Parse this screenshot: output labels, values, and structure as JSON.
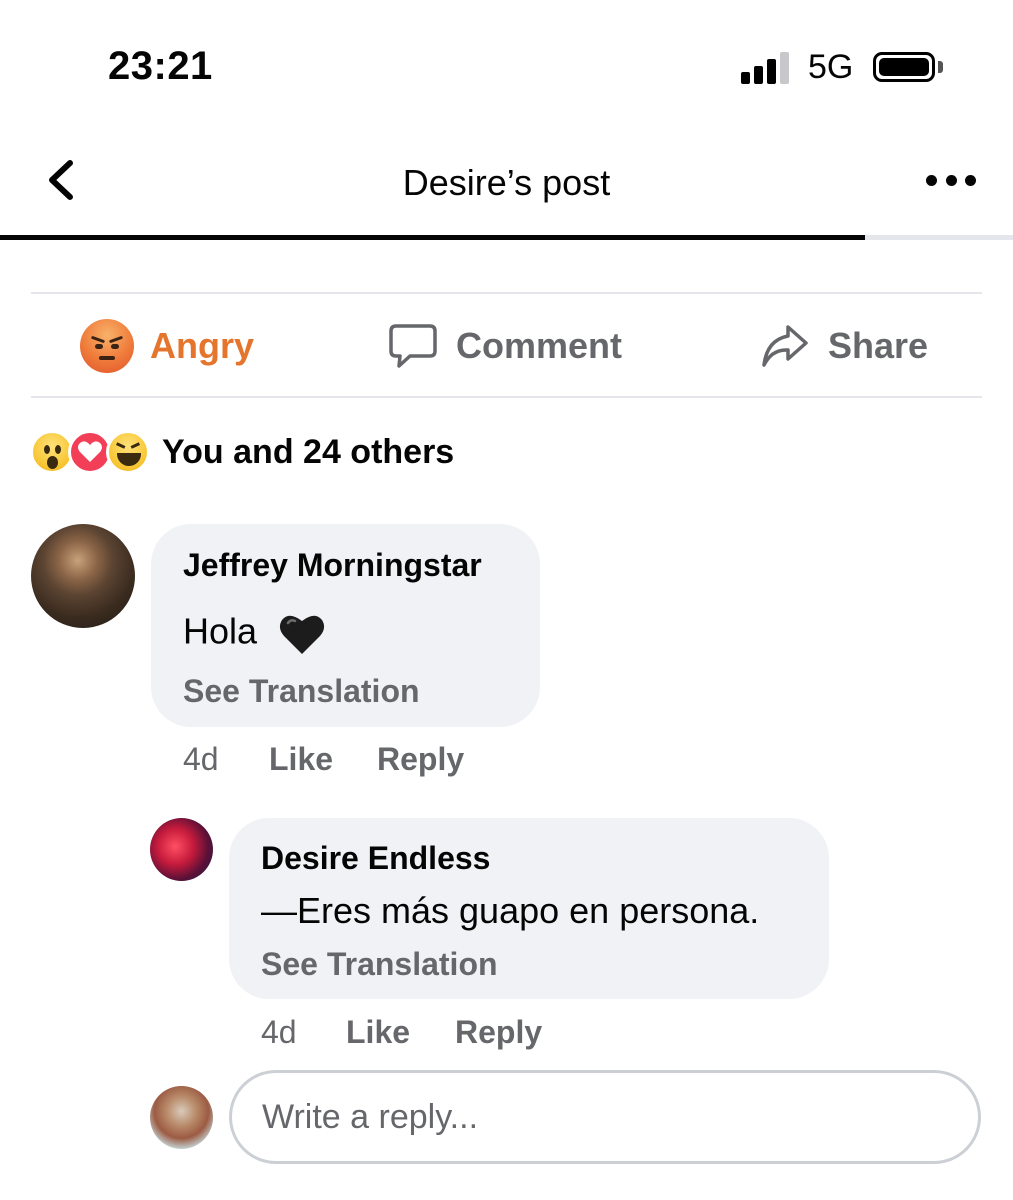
{
  "status_bar": {
    "time": "23:21",
    "network": "5G"
  },
  "header": {
    "title": "Desire’s post"
  },
  "actions": {
    "react_label": "Angry",
    "comment_label": "Comment",
    "share_label": "Share"
  },
  "reactions_summary": {
    "text": "You and 24 others",
    "icons": [
      "wow-icon",
      "love-icon",
      "haha-icon"
    ]
  },
  "comments": [
    {
      "author": "Jeffrey Morningstar",
      "text": "Hola",
      "emoji": "black-heart-icon",
      "translate_label": "See Translation",
      "time": "4d",
      "like_label": "Like",
      "reply_label": "Reply"
    },
    {
      "author": "Desire Endless",
      "text": "—Eres más guapo en persona.",
      "translate_label": "See Translation",
      "time": "4d",
      "like_label": "Like",
      "reply_label": "Reply"
    }
  ],
  "reply_box": {
    "placeholder": "Write a reply..."
  },
  "colors": {
    "angry_accent": "#e5752d",
    "secondary_text": "#65676b",
    "bubble_bg": "#f0f2f5"
  }
}
